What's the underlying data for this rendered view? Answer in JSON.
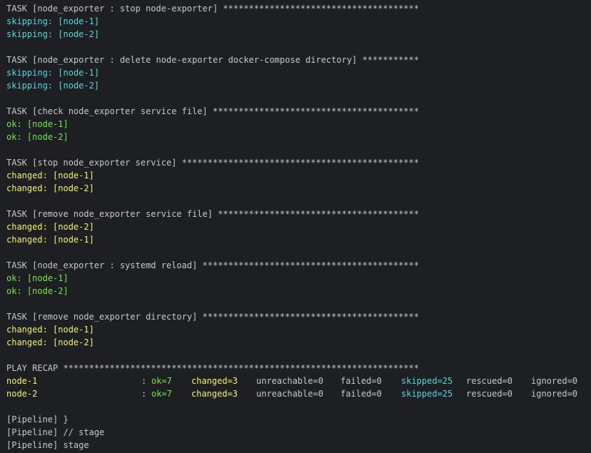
{
  "colors": {
    "background": "#1e1f22",
    "text": "#c8c8c8",
    "skipping": "#56d7e0",
    "ok": "#6fe84a",
    "changed": "#f3f36a"
  },
  "tasks": [
    {
      "header": "TASK [node_exporter : stop node-exporter] **************************************",
      "results": [
        {
          "status": "skipping:",
          "host": "[node-1]"
        },
        {
          "status": "skipping:",
          "host": "[node-2]"
        }
      ]
    },
    {
      "header": "TASK [node_exporter : delete node-exporter docker-compose directory] ***********",
      "results": [
        {
          "status": "skipping:",
          "host": "[node-1]"
        },
        {
          "status": "skipping:",
          "host": "[node-2]"
        }
      ]
    },
    {
      "header": "TASK [check node_exporter service file] ****************************************",
      "results": [
        {
          "status": "ok:",
          "host": "[node-1]"
        },
        {
          "status": "ok:",
          "host": "[node-2]"
        }
      ]
    },
    {
      "header": "TASK [stop node_exporter service] **********************************************",
      "results": [
        {
          "status": "changed:",
          "host": "[node-1]"
        },
        {
          "status": "changed:",
          "host": "[node-2]"
        }
      ]
    },
    {
      "header": "TASK [remove node_exporter service file] ***************************************",
      "results": [
        {
          "status": "changed:",
          "host": "[node-2]"
        },
        {
          "status": "changed:",
          "host": "[node-1]"
        }
      ]
    },
    {
      "header": "TASK [node_exporter : systemd reload] ******************************************",
      "results": [
        {
          "status": "ok:",
          "host": "[node-1]"
        },
        {
          "status": "ok:",
          "host": "[node-2]"
        }
      ]
    },
    {
      "header": "TASK [remove node_exporter directory] ******************************************",
      "results": [
        {
          "status": "changed:",
          "host": "[node-1]"
        },
        {
          "status": "changed:",
          "host": "[node-2]"
        }
      ]
    }
  ],
  "recap": {
    "header": "PLAY RECAP *********************************************************************",
    "rows": [
      {
        "host": "node-1",
        "colon": ":",
        "ok": "ok=7",
        "changed": "changed=3",
        "unreachable": "unreachable=0",
        "failed": "failed=0",
        "skipped": "skipped=25",
        "rescued": "rescued=0",
        "ignored": "ignored=0"
      },
      {
        "host": "node-2",
        "colon": ":",
        "ok": "ok=7",
        "changed": "changed=3",
        "unreachable": "unreachable=0",
        "failed": "failed=0",
        "skipped": "skipped=25",
        "rescued": "rescued=0",
        "ignored": "ignored=0"
      }
    ]
  },
  "pipeline": [
    "[Pipeline] }",
    "[Pipeline] // stage",
    "[Pipeline] stage"
  ]
}
